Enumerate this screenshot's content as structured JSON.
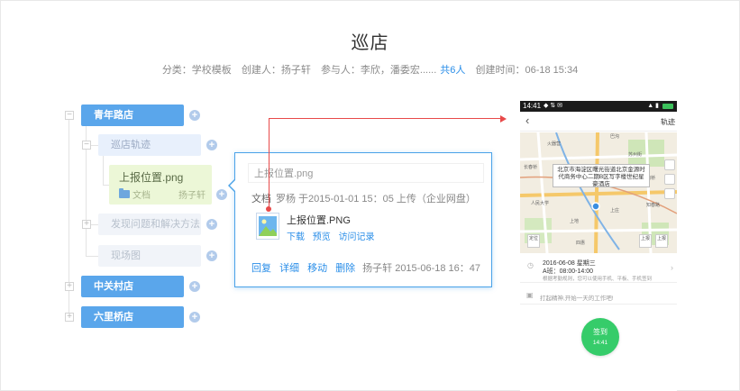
{
  "page": {
    "title": "巡店",
    "meta": {
      "category": "分类：学校模板",
      "creator": "创建人：扬子轩",
      "participants": "参与人：李欣，潘委宏......",
      "participants_count": "共6人",
      "created_time": "创建时间：06-18 15:34"
    }
  },
  "tree": {
    "nodes": [
      {
        "label": "青年路店"
      },
      {
        "label": "巡店轨迹"
      },
      {
        "label": "发现问题和解决方法"
      },
      {
        "label": "现场图"
      },
      {
        "label": "中关村店"
      },
      {
        "label": "六里桥店"
      }
    ],
    "toggle_minus": "−",
    "toggle_plus": "+",
    "add_symbol": "+",
    "file_card": {
      "name": "上报位置.png",
      "type": "文档",
      "owner": "扬子轩"
    }
  },
  "popup": {
    "input_value": "上报位置.png",
    "info_label": "文档",
    "info_text": "罗杨  于2015-01-01 15：05 上传（企业网盘）",
    "file_name": "上报位置.PNG",
    "file_actions": [
      "下载",
      "预览",
      "访问记录"
    ],
    "bottom_actions": [
      "回复",
      "详细",
      "移动",
      "删除"
    ],
    "stamp": "扬子轩 2015-06-18 16：47"
  },
  "phone": {
    "status_time": "14:41",
    "status_icons": "◆ ⇅ ✉",
    "status_signal": "▲ ▮",
    "back_icon": "‹",
    "track_label": "轨迹",
    "callout": "北京市海淀区曙光街道北京金源时代商务中心二期B区写字楼世纪星豪酒店",
    "map_labels": [
      "巴沟",
      "苏州街",
      "长春桥",
      "火器营",
      "上庄",
      "苏州桥",
      "人民大学",
      "知春路",
      "上地",
      "四惠"
    ],
    "map_btn_left": "定位",
    "map_btn_mid": "上报",
    "map_btn_right": "上报",
    "checkin_line1": "2016-06-08 星期三",
    "checkin_line2": "A班：08:00-14:00",
    "checkin_line3": "根据考勤规则，您可以使用手机、平板、手机签到",
    "work_hint": "打起精神,开始一天的工作吧!",
    "checkin_button": "签到",
    "checkin_time": "14:41"
  },
  "colors": {
    "primary_node": "#5aa6eb",
    "link": "#2a8ee8",
    "connector": "#e84a4a",
    "checkin_green": "#36cc6a"
  }
}
